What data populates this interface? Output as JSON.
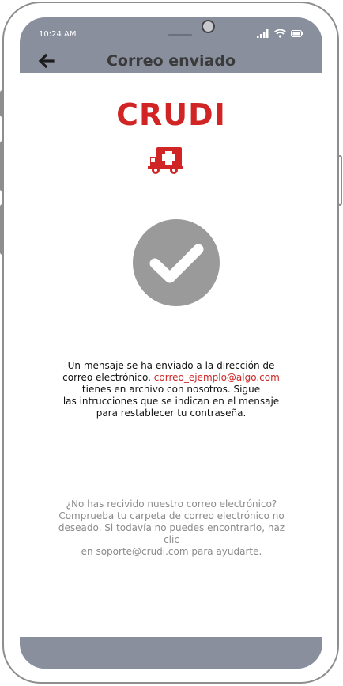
{
  "status_bar": {
    "time": "10:24 AM",
    "icons": [
      "signal-icon",
      "wifi-icon",
      "battery-icon"
    ]
  },
  "header": {
    "title": "Correo enviado",
    "back_icon": "arrow-left-icon"
  },
  "brand": {
    "name": "CRUDI",
    "logo_icon": "ambulance-icon"
  },
  "status_icon": "check-circle-icon",
  "message": {
    "part1": "Un mensaje se ha enviado a la dirección de correo electrónico.",
    "email": "correo_ejemplo@algo.com",
    "part2": "tienes en archivo con nosotros. Sigue",
    "part3": "las intrucciones que se indican en el mensaje para restablecer tu contraseña."
  },
  "help": {
    "text": "¿No has recivido nuestro correo electrónico? Comprueba tu carpeta de correo electrónico no deseado. Si todavía no puedes encontrarlo, haz clic",
    "text2": "en soporte@crudi.com para ayudarte."
  },
  "colors": {
    "accent": "#d12525",
    "chrome": "#8a8f9e",
    "check": "#9a9a9a"
  }
}
